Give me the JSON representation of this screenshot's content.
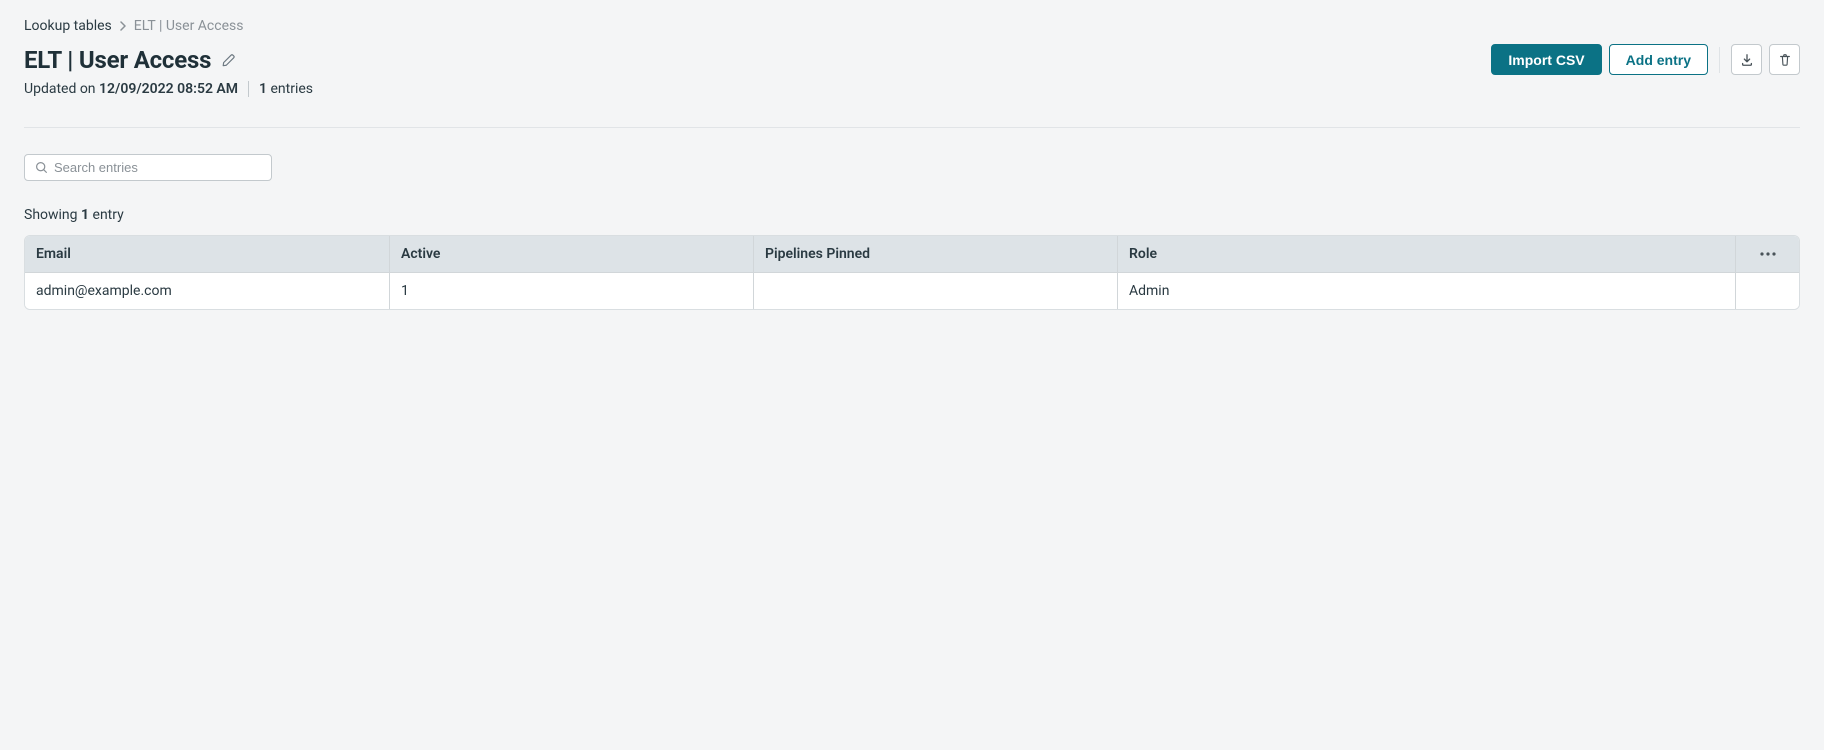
{
  "breadcrumb": {
    "root": "Lookup tables",
    "current": "ELT | User Access"
  },
  "header": {
    "title": "ELT | User Access",
    "import_csv_label": "Import CSV",
    "add_entry_label": "Add entry"
  },
  "meta": {
    "updated_prefix": "Updated on ",
    "updated_date": "12/09/2022 08:52 AM",
    "entries_count": "1",
    "entries_word": "entries"
  },
  "search": {
    "placeholder": "Search entries"
  },
  "showing": {
    "prefix": "Showing ",
    "count": "1",
    "suffix": " entry"
  },
  "table": {
    "headers": {
      "email": "Email",
      "active": "Active",
      "pinned": "Pipelines Pinned",
      "role": "Role"
    },
    "rows": [
      {
        "email": "admin@example.com",
        "active": "1",
        "pinned": "",
        "role": "Admin"
      }
    ]
  }
}
